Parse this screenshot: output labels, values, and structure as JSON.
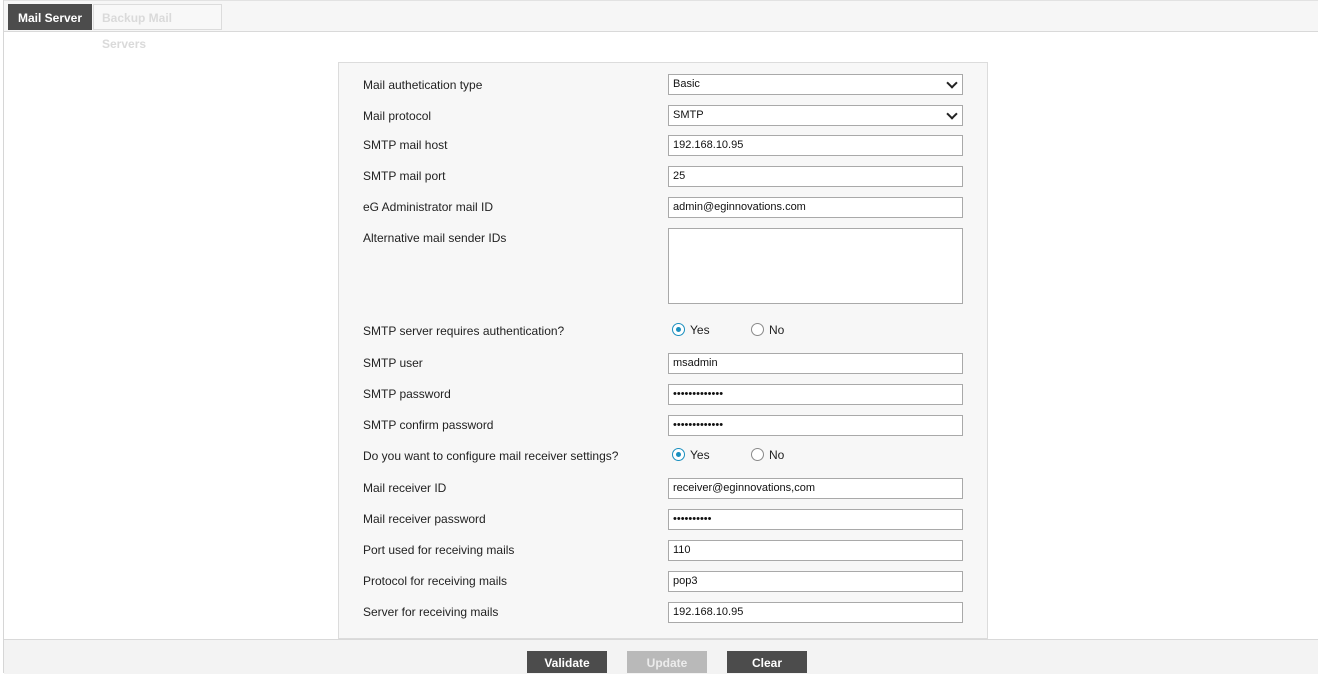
{
  "tabs": [
    {
      "label": "Mail Server",
      "active": true
    },
    {
      "label": "Backup Mail Servers",
      "active": false
    }
  ],
  "form": {
    "auth_type": {
      "label": "Mail authetication type",
      "value": "Basic"
    },
    "protocol": {
      "label": "Mail protocol",
      "value": "SMTP"
    },
    "smtp_host": {
      "label": "SMTP mail host",
      "value": "192.168.10.95"
    },
    "smtp_port": {
      "label": "SMTP mail port",
      "value": "25"
    },
    "admin_mail": {
      "label": "eG Administrator mail ID",
      "value": "admin@eginnovations.com"
    },
    "alt_sender": {
      "label": "Alternative mail sender IDs",
      "value": ""
    },
    "smtp_auth": {
      "label": "SMTP server requires authentication?",
      "options": [
        "Yes",
        "No"
      ],
      "selected": "Yes"
    },
    "smtp_user": {
      "label": "SMTP user",
      "value": "msadmin"
    },
    "smtp_password": {
      "label": "SMTP password",
      "value": "•••••••••••••"
    },
    "smtp_confirm_password": {
      "label": "SMTP confirm password",
      "value": "•••••••••••••"
    },
    "receiver_settings": {
      "label": "Do you want to configure mail receiver settings?",
      "options": [
        "Yes",
        "No"
      ],
      "selected": "Yes"
    },
    "receiver_id": {
      "label": "Mail receiver ID",
      "value": "receiver@eginnovations,com"
    },
    "receiver_password": {
      "label": "Mail receiver password",
      "value": "••••••••••"
    },
    "receive_port": {
      "label": "Port used for receiving mails",
      "value": "110"
    },
    "receive_protocol": {
      "label": "Protocol for receiving mails",
      "value": "pop3"
    },
    "receive_server": {
      "label": "Server for receiving mails",
      "value": "192.168.10.95"
    }
  },
  "footer": {
    "validate_label": "Validate",
    "update_label": "Update",
    "clear_label": "Clear"
  },
  "colors": {
    "accent": "#1a8fbf",
    "button": "#4c4c4c",
    "button_disabled": "#b9b9b9"
  }
}
